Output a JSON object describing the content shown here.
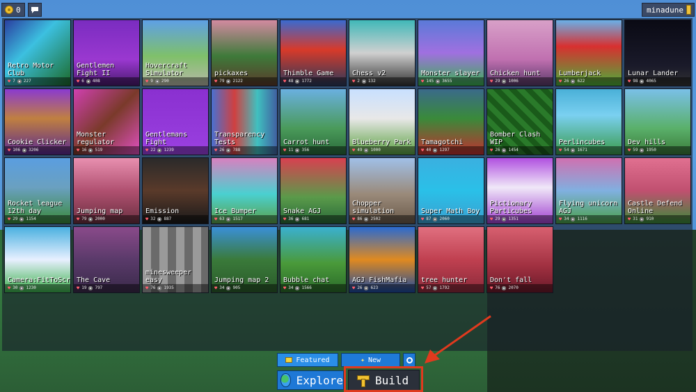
{
  "topbar": {
    "coins": "0",
    "username": "minadune"
  },
  "games": [
    {
      "title": "Retro Motor Club",
      "likes": "7",
      "views": "227",
      "bg": "linear-gradient(135deg,#2a3fa0 0%,#3cc0e0 40%,#1c6a2a 100%)"
    },
    {
      "title": "Gentlemen Fight II",
      "likes": "6",
      "views": "408",
      "bg": "linear-gradient(180deg,#7a2cc0 0%,#9a38d0 60%,#4a1a70 100%)"
    },
    {
      "title": "Hovercraft Simulator",
      "likes": "9",
      "views": "290",
      "bg": "linear-gradient(180deg,#5ea0e6 0%,#7fc06a 55%,#b8b8a8 100%)"
    },
    {
      "title": "pickaxes",
      "likes": "79",
      "views": "2122",
      "bg": "linear-gradient(180deg,#d28aa0 0%,#3e7a3a 55%,#5a3a2a 100%)"
    },
    {
      "title": "Thimble Game",
      "likes": "48",
      "views": "1772",
      "bg": "linear-gradient(180deg,#3a6ad0 0%,#d83a2a 45%,#2a3a5a 100%)"
    },
    {
      "title": "Chess v2",
      "likes": "2",
      "views": "132",
      "bg": "linear-gradient(180deg,#40b8b8 0%,#d0d0d0 50%,#333 100%)"
    },
    {
      "title": "Monster slayer",
      "likes": "145",
      "views": "3655",
      "bg": "linear-gradient(180deg,#5a7ad8 0%,#a070e0 50%,#3ab050 100%)"
    },
    {
      "title": "Chicken hunt",
      "likes": "29",
      "views": "1006",
      "bg": "linear-gradient(180deg,#d8a0c8 0%,#c070b0 60%,#5a3a6a 100%)"
    },
    {
      "title": "Lumberjack",
      "likes": "26",
      "views": "622",
      "bg": "linear-gradient(180deg,#6ab0e8 0%,#d83030 40%,#4cae3a 100%)"
    },
    {
      "title": "Lunar Lander",
      "likes": "98",
      "views": "4065",
      "bg": "linear-gradient(180deg,#0a0a14 0%,#1a1a2a 70%,#333 100%)"
    },
    {
      "title": "Cookie Clicker",
      "likes": "106",
      "views": "3206",
      "bg": "linear-gradient(180deg,#8a3ad0 0%,#c08040 45%,#5a2a90 100%)"
    },
    {
      "title": "Monster regulator",
      "likes": "16",
      "views": "519",
      "bg": "linear-gradient(135deg,#d040b0 0%,#7a3a2a 50%,#e050c0 100%)"
    },
    {
      "title": "Gentlemans Fight",
      "likes": "22",
      "views": "1239",
      "bg": "linear-gradient(180deg,#8a30d0 0%,#9a40e0 100%)"
    },
    {
      "title": "Transparency Tests",
      "likes": "26",
      "views": "788",
      "bg": "linear-gradient(90deg,#4a70d0 0%,#d04040 35%,#40c0c0 70%,#4060a0 100%)"
    },
    {
      "title": "Carrot hunt",
      "likes": "11",
      "views": "356",
      "bg": "linear-gradient(180deg,#6ab0e0 0%,#4a9a5a 60%,#2a6a3a 100%)"
    },
    {
      "title": "Blueberry Park",
      "likes": "49",
      "views": "1000",
      "bg": "linear-gradient(180deg,#c8e0ff 0%,#e8e8e8 45%,#5aa040 100%)"
    },
    {
      "title": "Tamagotchi",
      "likes": "40",
      "views": "1297",
      "bg": "linear-gradient(180deg,#3a6a8a 0%,#3a8a3a 45%,#c03030 100%)"
    },
    {
      "title": "Bomber Clash WIP",
      "likes": "26",
      "views": "1454",
      "bg": "repeating-linear-gradient(45deg,#2a7a2a 0 8px,#1a5a1a 8px 16px)"
    },
    {
      "title": "Perlincubes",
      "likes": "54",
      "views": "1671",
      "bg": "linear-gradient(180deg,#4ab0d8 0%,#7ad0f0 40%,#3a9a4a 100%)"
    },
    {
      "title": "Dev hills",
      "likes": "59",
      "views": "1950",
      "bg": "linear-gradient(180deg,#7ac0e8 0%,#5ab06a 60%,#3a7a3a 100%)"
    },
    {
      "title": "Rocket league 12th day",
      "likes": "29",
      "views": "1154",
      "bg": "linear-gradient(180deg,#5a9ee0 0%,#6aa0c0 45%,#3a8a3a 100%)"
    },
    {
      "title": "Jumping map",
      "likes": "79",
      "views": "2000",
      "bg": "linear-gradient(180deg,#e890b0 0%,#b05070 50%,#6a3040 100%)"
    },
    {
      "title": "Emission",
      "likes": "32",
      "views": "887",
      "bg": "linear-gradient(180deg,#2a2a2a 0%,#5a3a2a 50%,#1a1a1a 100%)"
    },
    {
      "title": "Ice Bumper",
      "likes": "63",
      "views": "1517",
      "bg": "linear-gradient(180deg,#d880c0 0%,#4ad0d0 55%,#5aa04a 100%)"
    },
    {
      "title": "Snake AGJ",
      "likes": "36",
      "views": "681",
      "bg": "linear-gradient(180deg,#d84050 0%,#5a9a4a 60%,#2a6a3a 100%)"
    },
    {
      "title": "Chopper simulation",
      "likes": "86",
      "views": "2502",
      "bg": "linear-gradient(180deg,#a0c0e8 0%,#9a8a7a 55%,#6a5a4a 100%)"
    },
    {
      "title": "Super Math Boy",
      "likes": "87",
      "views": "2060",
      "bg": "linear-gradient(180deg,#3ab0e0 0%,#2ac0e8 50%,#3aa0d0 100%)"
    },
    {
      "title": "Pictionary Particubes",
      "likes": "29",
      "views": "1351",
      "bg": "linear-gradient(180deg,#b050e0 0%,#f0e8f8 45%,#a040d0 100%)"
    },
    {
      "title": "Flying unicorn AGJ",
      "likes": "34",
      "views": "1116",
      "bg": "linear-gradient(180deg,#d070b0 0%,#80b0e0 50%,#4aa04a 100%)"
    },
    {
      "title": "Castle Defend Online",
      "likes": "31",
      "views": "910",
      "bg": "linear-gradient(180deg,#e07090 0%,#c05070 50%,#3a8a3a 100%)"
    },
    {
      "title": "Camera:FitToScreen",
      "likes": "30",
      "views": "1230",
      "bg": "linear-gradient(180deg,#4ab0e0 0%,#e8f0ff 50%,#3ab04a 100%)"
    },
    {
      "title": "The Cave",
      "likes": "19",
      "views": "797",
      "bg": "linear-gradient(180deg,#8a4a8a 0%,#5a3a6a 50%,#3a2a4a 100%)"
    },
    {
      "title": "minesweeper easy",
      "likes": "76",
      "views": "1935",
      "bg": "repeating-linear-gradient(90deg,#9a9a9a 0 12px,#6a6a6a 12px 24px)"
    },
    {
      "title": "Jumping map 2",
      "likes": "34",
      "views": "905",
      "bg": "linear-gradient(180deg,#3a90d8 0%,#3a7a3a 50%,#2a5a2a 100%)"
    },
    {
      "title": "Bubble chat",
      "likes": "34",
      "views": "1566",
      "bg": "linear-gradient(180deg,#3ab0d0 0%,#4a9a3a 55%,#2a6a2a 100%)"
    },
    {
      "title": "AGJ FishMafia",
      "likes": "26",
      "views": "623",
      "bg": "linear-gradient(180deg,#2a6ad0 0%,#e08a20 50%,#1a4aa0 100%)"
    },
    {
      "title": "tree hunter",
      "likes": "57",
      "views": "1792",
      "bg": "linear-gradient(180deg,#e07080 0%,#c04050 50%,#8a2a3a 100%)"
    },
    {
      "title": "Don't fall",
      "likes": "76",
      "views": "2070",
      "bg": "linear-gradient(180deg,#d86070 0%,#a03040 60%,#6a1a2a 100%)"
    }
  ],
  "tabs": {
    "featured": "Featured",
    "new": "New"
  },
  "nav": {
    "explore": "Explore",
    "build": "Build"
  },
  "colors": {
    "highlight": "#e03a1e"
  }
}
